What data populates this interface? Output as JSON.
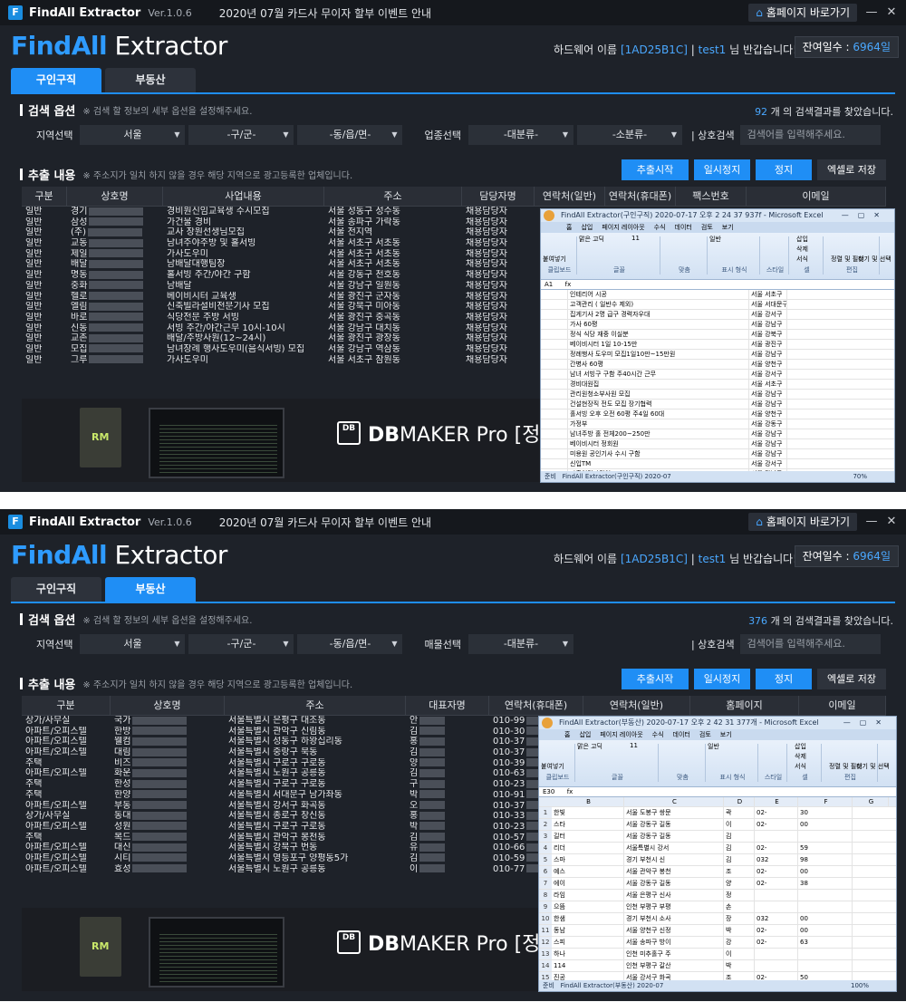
{
  "app": {
    "name": "FindAll Extractor",
    "version": "Ver.1.0.6",
    "notice": "2020년 07월 카드사 무이자 할부 이벤트 안내",
    "home_button": "홈페이지 바로가기",
    "brand_part1": "FindAll",
    "brand_part2": " Extractor",
    "hw_label": "하드웨어 이름",
    "hw_id": "[1AD25B1C]",
    "separator": "|",
    "user_id": "test1",
    "greeting": "님 반갑습니다!",
    "days_label": "잔여일수 : ",
    "days_value": "6964일"
  },
  "tabs": [
    "구인구직",
    "부동산"
  ],
  "search": {
    "title": "검색 옵션",
    "note": "※ 검색 할 정보의 세부 옵션을 설정해주세요.",
    "region_label": "지역선택",
    "region_value": "서울",
    "district_value": "-구/군-",
    "dong_value": "-동/읍/면-",
    "shop_search_label": "| 상호검색",
    "shop_search_placeholder": "검색어를 입력해주세요.",
    "result_suffix": "개 의 검색결과를 찾았습니다."
  },
  "extract": {
    "title": "추출 내용",
    "note": "※ 주소지가 일치 하지 않을 경우 해당 지역으로 광고등록한 업체입니다.",
    "start": "추출시작",
    "pause": "일시정지",
    "stop": "정지",
    "excel": "엑셀로 저장"
  },
  "banner": {
    "logo": "DB",
    "product_bold": "DB",
    "product_rest": "MAKER Pro [정식",
    "box_logo": "RM"
  },
  "panel1": {
    "result_count": "92",
    "industry_label": "업종선택",
    "cat1": "-대분류-",
    "cat2": "-소분류-",
    "columns": [
      "구분",
      "상호명",
      "사업내용",
      "주소",
      "담당자명",
      "연락처(일반)",
      "연락처(휴대폰)",
      "팩스번호",
      "이메일"
    ],
    "rows": [
      [
        "일반",
        "경기",
        "경비원신임교육생 수시모집",
        "서울 성동구 성수동",
        "채용담당자"
      ],
      [
        "일반",
        "삼성",
        "가건물 경비",
        "서울 송파구 가락동",
        "채용담당자"
      ],
      [
        "일반",
        "(주)",
        "교사 장원선생님모집",
        "서울 전지역",
        "채용담당자"
      ],
      [
        "일반",
        "교동",
        "남녀주야주방 및 홀서빙",
        "서울 서초구 서초동",
        "채용담당자"
      ],
      [
        "일반",
        "제일",
        "가사도우미",
        "서울 서초구 서초동",
        "채용담당자"
      ],
      [
        "일반",
        "배달",
        "남배달대행팀장",
        "서울 서초구 서초동",
        "채용담당자"
      ],
      [
        "일반",
        "명동",
        "홀서빙 주간/야간 구함",
        "서울 강동구 천호동",
        "채용담당자"
      ],
      [
        "일반",
        "중화",
        "남배달",
        "서울 강남구 일원동",
        "채용담당자"
      ],
      [
        "일반",
        "헬로",
        "베이비시터 교육생",
        "서울 광진구 군자동",
        "채용담당자"
      ],
      [
        "일반",
        "엘림",
        "신축빌라설비전문기사 모집",
        "서울 강북구 미아동",
        "채용담당자"
      ],
      [
        "일반",
        "바로",
        "식당전문 주방 서빙",
        "서울 광진구 중곡동",
        "채용담당자"
      ],
      [
        "일반",
        "신동",
        "서빙 주간/야간근무 10시-10시",
        "서울 강남구 대치동",
        "채용담당자"
      ],
      [
        "일반",
        "교촌",
        "배달/주방사원(12~24시)",
        "서울 광진구 광장동",
        "채용담당자"
      ],
      [
        "일반",
        "모집",
        "남녀장례 행사도우미(음식서빙) 모집",
        "서울 강남구 역삼동",
        "채용담당자"
      ],
      [
        "일반",
        "그루",
        "가사도우미",
        "서울 서초구 잠원동",
        "채용담당자"
      ]
    ],
    "excel_title": "FindAll Extractor(구인구직) 2020-07-17 오후 2 24 37 937f - Microsoft Excel",
    "excel_sheet": "FindAll Extractor(구인구직) 2020-07",
    "excel_zoom": "70%",
    "excel_rows": [
      [
        "",
        "인테리어 시공",
        "서울 서초구"
      ],
      [
        "",
        "고객관리 ( 일반수 제외)",
        "서울 서대문구"
      ],
      [
        "",
        "집게기사 2명 급구 경력자우대",
        "서울 강서구"
      ],
      [
        "",
        "가사 60평",
        "서울 강남구"
      ],
      [
        "",
        "정식 식당 재중 이실분",
        "서울 강북구"
      ],
      [
        "",
        "베이비시터 1일 10-15만",
        "서울 광진구"
      ],
      [
        "",
        "정례행사 도우미 모집1일10만~15만원",
        "서울 강남구"
      ],
      [
        "",
        "간병사 60평",
        "서울 양천구"
      ],
      [
        "",
        "남녀 서빙구 구함 주40시간 근무",
        "서울 강서구"
      ],
      [
        "",
        "경비대원집",
        "서울 서초구"
      ],
      [
        "",
        "관리원청소부사원 모집",
        "서울 강남구"
      ],
      [
        "",
        "건설현장직 전도 모집 장기협력",
        "서울 강남구"
      ],
      [
        "",
        "홀서빙 오후 오전 60평 주4일 60대",
        "서울 양천구"
      ],
      [
        "",
        "가정부",
        "서울 강동구"
      ],
      [
        "",
        "남녀주방 홀 전체200~250만",
        "서울 강남구"
      ],
      [
        "",
        "베이비시터 정회원",
        "서울 강남구"
      ],
      [
        "",
        "미용원 공인기사 수시 구함",
        "서울 강남구"
      ],
      [
        "",
        "신입TM",
        "서울 강서구"
      ],
      [
        "",
        "파출인력파견업",
        "서울 강남구"
      ],
      [
        "",
        "남녀택시기사 모집 초보 여성환영 2명팀으로가능",
        "서울 강동구"
      ],
      [
        "",
        "주방보조전 홀서빙필요해시간/정함 식당일자리 가정업종조 조보가능",
        "서울 강동구"
      ],
      [
        "",
        "산후관리사 베이비시터 3~6일 무료교육후 취시취업가능 최고급여",
        "서울 강동구"
      ]
    ],
    "excel_cell": "A1"
  },
  "panel2": {
    "result_count": "376",
    "property_label": "매물선택",
    "cat1": "-대분류-",
    "columns": [
      "구분",
      "상호명",
      "주소",
      "대표자명",
      "연락처(휴대폰)",
      "연락처(일반)",
      "홈페이지",
      "이메일"
    ],
    "rows": [
      [
        "상가/사무실",
        "국가",
        "서울특별시 은평구 대조동",
        "안",
        "010-99"
      ],
      [
        "아파트/오피스텔",
        "한방",
        "서울특별시 관악구 신림동",
        "김",
        "010-30"
      ],
      [
        "아파트/오피스텔",
        "웰컴",
        "서울특별시 성동구 하왕십리동",
        "홍",
        "010-37"
      ],
      [
        "아파트/오피스텔",
        "대림",
        "서울특별시 중랑구 묵동",
        "김",
        "010-37"
      ],
      [
        "주택",
        "비즈",
        "서울특별시 구로구 구로동",
        "양",
        "010-39"
      ],
      [
        "아파트/오피스텔",
        "화운",
        "서울특별시 노원구 공릉동",
        "김",
        "010-63"
      ],
      [
        "주택",
        "한성",
        "서울특별시 구로구 구로동",
        "구",
        "010-23"
      ],
      [
        "주택",
        "한양",
        "서울특별시 서대문구 남가좌동",
        "박",
        "010-91"
      ],
      [
        "아파트/오피스텔",
        "부동",
        "서울특별시 강서구 화곡동",
        "오",
        "010-37"
      ],
      [
        "상가/사무실",
        "동대",
        "서울특별시 종로구 창신동",
        "홍",
        "010-33"
      ],
      [
        "아파트/오피스텔",
        "성원",
        "서울특별시 구로구 구로동",
        "박",
        "010-23"
      ],
      [
        "주택",
        "복드",
        "서울특별시 관악구 봉천동",
        "김",
        "010-57"
      ],
      [
        "아파트/오피스텔",
        "대신",
        "서울특별시 강북구 번동",
        "유",
        "010-66"
      ],
      [
        "아파트/오피스텔",
        "시티",
        "서울특별시 영등포구 양평동5가",
        "김",
        "010-59"
      ],
      [
        "아파트/오피스텔",
        "효성",
        "서울특별시 노원구 공릉동",
        "이",
        "010-77"
      ]
    ],
    "excel_title": "FindAll Extractor(부동산) 2020-07-17 오후 2 42 31 377개 - Microsoft Excel",
    "excel_sheet": "FindAll Extractor(부동산) 2020-07",
    "excel_zoom": "100%",
    "excel_cell": "E30",
    "excel_col_headers": [
      "B",
      "C",
      "D",
      "E",
      "F",
      "G"
    ],
    "excel_rows": [
      [
        "1",
        "한빛",
        "서울 도봉구 쌍문",
        "곽",
        "02-",
        "30"
      ],
      [
        "2",
        "스타",
        "서울 강동구 길동",
        "이",
        "02-",
        "00"
      ],
      [
        "3",
        "길터",
        "서울 강동구 길동",
        "김",
        "",
        ""
      ],
      [
        "4",
        "리더",
        "서울특별시 강서",
        "김",
        "02-",
        "59"
      ],
      [
        "5",
        "스마",
        "경기 부천시 신",
        "김",
        "032",
        "98"
      ],
      [
        "6",
        "예스",
        "서울 관악구 봉천",
        "조",
        "02-",
        "00"
      ],
      [
        "7",
        "에이",
        "서울 강동구 길동",
        "양",
        "02-",
        "38"
      ],
      [
        "8",
        "라임",
        "서울 은평구 신사",
        "정",
        "",
        ""
      ],
      [
        "9",
        "으뜸",
        "인천 부평구 부평",
        "손",
        "",
        ""
      ],
      [
        "10",
        "한샘",
        "경기 부천시 소사",
        "장",
        "032",
        "00"
      ],
      [
        "11",
        "동남",
        "서울 양천구 신정",
        "박",
        "02-",
        "00"
      ],
      [
        "12",
        "스피",
        "서울 송파구 방이",
        "강",
        "02-",
        "63"
      ],
      [
        "13",
        "하나",
        "인천 미추홀구 주",
        "이",
        "",
        ""
      ],
      [
        "14",
        "114",
        "인천 부평구 갈산",
        "박",
        "",
        ""
      ],
      [
        "15",
        "진공",
        "서울 강서구 화곡",
        "조",
        "02-",
        "50"
      ]
    ]
  },
  "excel_ui": {
    "tabs": [
      "홈",
      "삽입",
      "페이지 레이아웃",
      "수식",
      "데이터",
      "검토",
      "보기"
    ],
    "font": "맑은 고딕",
    "size": "11",
    "format": "일반",
    "groups": [
      "클립보드",
      "글꼴",
      "맞춤",
      "표시 형식",
      "스타일",
      "셀",
      "편집"
    ],
    "paste": "붙여넣기",
    "insert": "삽입",
    "delete": "삭제",
    "format_cmd": "서식",
    "sort": "정렬 및 필터",
    "find": "찾기 및 선택",
    "status": "준비",
    "fx": "fx"
  }
}
